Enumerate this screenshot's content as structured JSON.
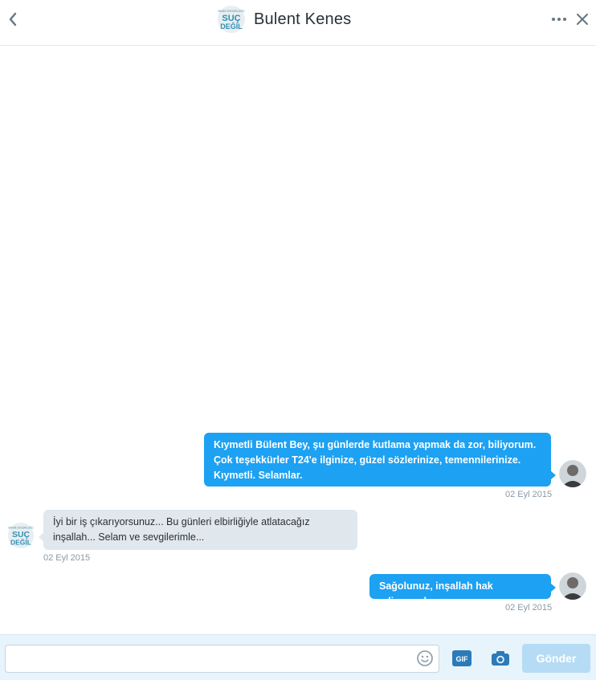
{
  "header": {
    "title": "Bulent Kenes",
    "avatar_logo_text": [
      "BASIN ÖZGÜRLÜĞÜ",
      "SUÇ",
      "DEĞİL"
    ]
  },
  "messages": [
    {
      "direction": "outgoing",
      "text": "Kıymetli Bülent Bey, şu günlerde kutlama yapmak da zor, biliyorum. Çok teşekkürler T24'e ilginize, güzel sözlerinize, temennilerinize. Kıymetli. Selamlar.",
      "time": "02 Eyl 2015"
    },
    {
      "direction": "incoming",
      "text": "İyi bir iş çıkarıyorsunuz... Bu günleri elbirliğiyle atlatacağız inşallah... Selam ve sevgilerimle...",
      "time": "02 Eyl 2015"
    },
    {
      "direction": "outgoing",
      "text": "Sağolunuz, inşallah hak ediyoruzdur.",
      "time": "02 Eyl 2015"
    }
  ],
  "composer": {
    "input_value": "",
    "input_placeholder": "",
    "gif_label": "GIF",
    "send_label": "Gönder"
  },
  "colors": {
    "accent": "#1da1f2",
    "incoming_bubble": "#e1e8ed",
    "send_disabled": "#b6dcf5",
    "icon": "#2b7bb9"
  },
  "icons": {
    "back": "chevron-left-icon",
    "more": "more-dots-icon",
    "close": "close-icon",
    "emoji": "emoji-icon",
    "gif": "gif-icon",
    "camera": "camera-icon"
  }
}
